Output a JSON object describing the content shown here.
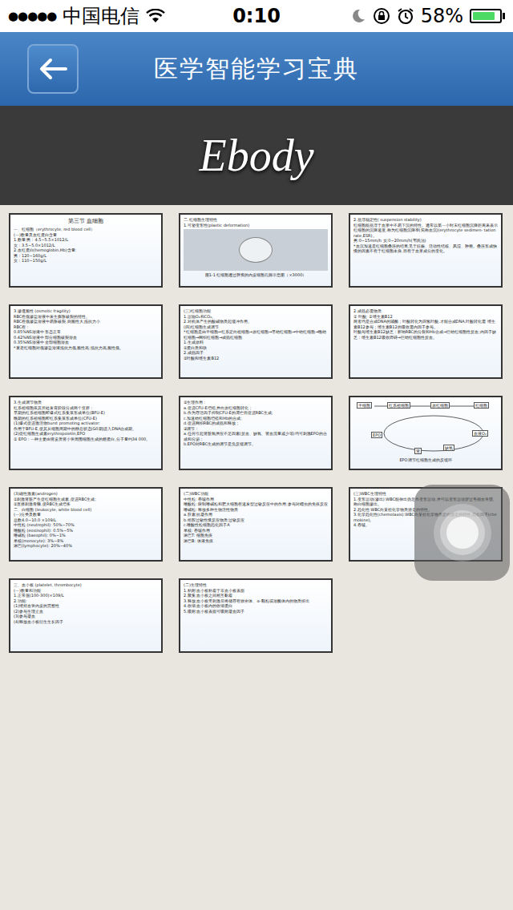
{
  "status_bar": {
    "signal": "●●●●●",
    "carrier": "中国电信",
    "time": "0:10",
    "battery": "58%",
    "battery_level": 0.85
  },
  "nav": {
    "title": "医学智能学习宝典"
  },
  "banner": {
    "logo": "Ebody"
  },
  "slides": [
    {
      "kind": "text",
      "heading": "第三节 血细胞",
      "lines": [
        "一、红细胞（erythrocyte, red blood cell）",
        "(一)数量及血红蛋白含量",
        "1.数量:男：4.5~5.5×1012/L",
        "女：3.5~5.0×1012/L",
        "2.血红蛋白(hemoglobin,Hb)含量:",
        "男：120~160g/L",
        "女：110~150g/L"
      ]
    },
    {
      "kind": "figure",
      "lines": [
        "二.红细胞生理特性",
        "1.可塑变形性(plastic deformation)"
      ],
      "caption": "图1-1 红细胞通过脾窦的内皮细胞孔隙示意图（×3000）"
    },
    {
      "kind": "text",
      "lines": [
        "2.悬浮稳定性( suspension stability)",
        "红细胞能悬浮于血浆中不易下沉的特性。通常以第一小时末红细胞沉降距离来表示红细胞的沉降速度,称为红细胞沉降率(简称血沉)(erythrocyte sedimen- tation rate,ESR)。",
        "男:0~15mm/h 女:0~20mm/h(韦氏法)",
        "*血沉加速是红细胞叠连的结果,见于妊娠、活动性结核、风湿、肿瘤。叠连形成快慢的因素不在于红细胞本身,而在于血浆成分的变化。"
      ]
    },
    {
      "kind": "text",
      "lines": [
        "3.渗透脆性 (osmotic fragility)",
        "RBC在低渗盐溶液中发生膨胀破裂的特性。",
        "RBC在低渗盐溶液中易胀破裂,则脆性大,抵抗力小",
        "RBC在：",
        "0.85%NS溶液中 形态正常",
        "0.42%NS溶液中 部分细胞破裂溶血",
        "0.35%NS溶液中 全部细胞溶血",
        "*衰老红细胞对低渗盐溶液抵抗力低,脆性高;抵抗力高,脆性低。"
      ]
    },
    {
      "kind": "text",
      "lines": [
        "(三)红细胞功能",
        "1.运输O₂和CO₂。",
        "2.对机体产生的酸碱物质起缓冲作用。",
        "(四)红细胞生成调节",
        "*红细胞是由干细胞→红系定向祖细胞→原红细胞→早幼红细胞→中幼红细胞→晚幼红细胞→网织红细胞→成熟红细胞",
        "1.生成原料",
        "①蛋白质和铁",
        "2.成熟因子",
        "②叶酸和维生素B12"
      ]
    },
    {
      "kind": "text",
      "lines": [
        "2.成熟必需物质",
        "① 叶酸; ②维生素B12",
        "两者均是合成DNA的辅酶；叶酸转化为四氢叶酸,才能合成DNA,叶酸转化需 维生素B12参与；维生素B12的吸收需内因子参与。",
        "叶酸与维生素B12缺乏：影响RBC的分裂和Hb合成→巨幼红细胞性贫血;内因子缺乏：维生素B12吸收障碍→巨幼红细胞性贫血。"
      ]
    },
    {
      "kind": "text",
      "lines": [
        "3.生成调节物质",
        "红系祖细胞依其所处发育阶段分成两个亚群：",
        "早期的红系祖细胞即爆式红系集落形成单位(BFU-E)",
        "晚期的红系祖细胞即红系集落形成单位(CFU-E)",
        "(1)爆式促进激活物burst promoting activator:",
        "作用于BFU-E,使其从细胞周期中的静息状态(G0期)进入DNA合成期。",
        "(2)促红细胞生成素erythropoietin,EPO",
        "① EPO：一种主要由肾皮质肾小管周围细胞生成的糖蛋白,分子量约34 000。"
      ]
    },
    {
      "kind": "text",
      "lines": [
        "②生理作用：",
        "a.促进CFU-E增殖,并向原红细胞转化；",
        "b.作为存活因子抑制CFU-E的凋亡而促进RBC生成;",
        "c.加速幼红细胞增殖和Hb的合成;",
        "d.促进网织RBC的成熟和释放；",
        "③调节：",
        "a.任何引起肾脏氧供应不足因素(贫血、缺氧、肾血流量减少等)均可刺激EPO的合成和分泌；",
        "b.EPO对RBC生成的调节是负反馈调节。"
      ]
    },
    {
      "kind": "diagram",
      "labels": [
        "干细胞",
        "红系祖细胞",
        "原红细胞",
        "红细胞",
        "血液O₂",
        "缺氧",
        "肾",
        "EPO"
      ],
      "caption": "EPO调节红细胞生成的反馈环"
    },
    {
      "kind": "text",
      "lines": [
        "(3)雄性激素(androgen)",
        "①刺激肾脏产生促红细胞生成素,促进RBC生成;",
        "②直接刺激骨髓,使RBC生成增多",
        "二、白细胞 (leukocyte, white blood cell)",
        "(一)分类及数量",
        "总数4.0~10.0 ×109/L",
        "中性粒 (neutrophil): 50%~70%",
        "嗜酸粒 (eosinophil): 0.5%~5%",
        "嗜碱粒 (basophil): 0%~1%",
        "单核(monocyte): 3%~8%",
        "淋巴(lymphocyte): 20%~40%"
      ]
    },
    {
      "kind": "text",
      "lines": [
        "(二)WBC功能",
        "中性粒: 吞噬作用",
        "嗜酸粒: 限制嗜碱粒和肥大细胞在速发型过敏反应中的作用;参与对蠕虫的免疫反应",
        "嗜碱粒: 释放多种生物活性物质",
        "a.肝素:抗凝作用",
        "b.组胺过敏性慢反应物质:过敏反应",
        "c.嗜酸性粒细胞趋化因子A",
        "单核: 吞噬作用",
        "淋巴T: 细胞免疫",
        "淋巴B: 体液免疫"
      ]
    },
    {
      "kind": "text",
      "lines": [
        "(三)WBC生理特性",
        "1.变形运动(渗出):WBC能伸出伪足作变形运动,并可以变形运动穿过毛细血管壁,称白细胞渗出。",
        "2.趋化性:WBC向某些化学物质游走的特性。",
        "3.化学趋化性(chemotaxis):WBC向某些化学物质定向游走的特性,趋化因子(chemokine)。",
        "4.吞噬。"
      ]
    },
    {
      "kind": "text",
      "lines": [
        "三、血小板 (platelet, thrombocyte)",
        "(一)数量和功能",
        "1.正常值(100-300)×109/L",
        "2.功能:",
        "(1)维持血管内皮的完整性",
        "(2)参与生理止血",
        "(3)参与凝血",
        "(4)释放血小板衍生生长因子"
      ]
    },
    {
      "kind": "text",
      "lines": [
        "(二)生理特性",
        "1.粘附:血小板粘着于非血小板表面",
        "2.聚集:血小板之间相互黏着",
        "3.释放:血小板受刺激后将储存在致密体、α-颗粒或溶酶体内的物质排出",
        "4.收缩:血小板内的收缩蛋白",
        "5.吸附:血小板表面可吸附凝血因子"
      ]
    }
  ]
}
